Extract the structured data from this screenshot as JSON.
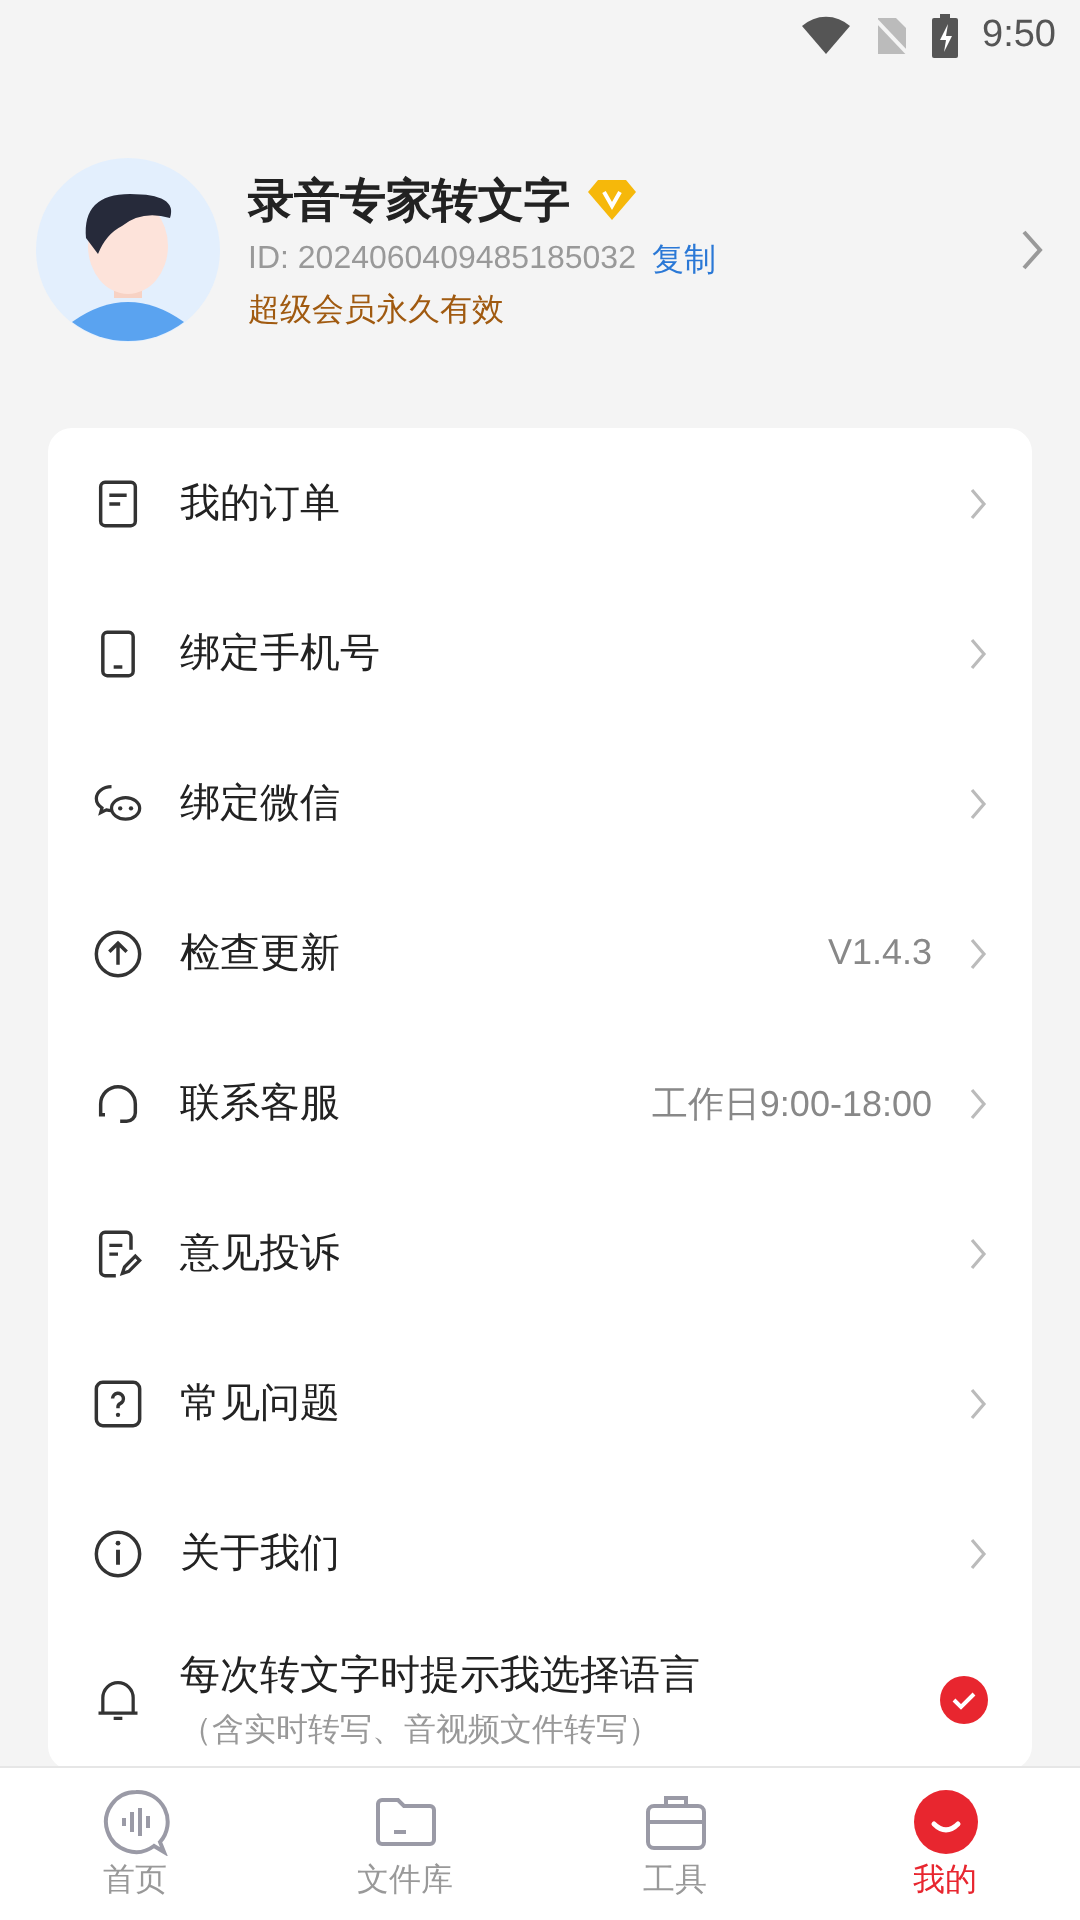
{
  "status_bar": {
    "time": "9:50"
  },
  "profile": {
    "name": "录音专家转文字",
    "id": "ID: 2024060409485185032",
    "copy": "复制",
    "membership": "超级会员永久有效"
  },
  "menu": [
    {
      "label": "我的订单"
    },
    {
      "label": "绑定手机号"
    },
    {
      "label": "绑定微信"
    },
    {
      "label": "检查更新",
      "value": "V1.4.3"
    },
    {
      "label": "联系客服",
      "value": "工作日9:00-18:00"
    },
    {
      "label": "意见投诉"
    },
    {
      "label": "常见问题"
    },
    {
      "label": "关于我们"
    }
  ],
  "language_prompt": {
    "label": "每次转文字时提示我选择语言",
    "note": "（含实时转写、音视频文件转写）",
    "checked": true
  },
  "tabs": [
    {
      "label": "首页",
      "selected": false
    },
    {
      "label": "文件库",
      "selected": false
    },
    {
      "label": "工具",
      "selected": false
    },
    {
      "label": "我的",
      "selected": true
    }
  ]
}
